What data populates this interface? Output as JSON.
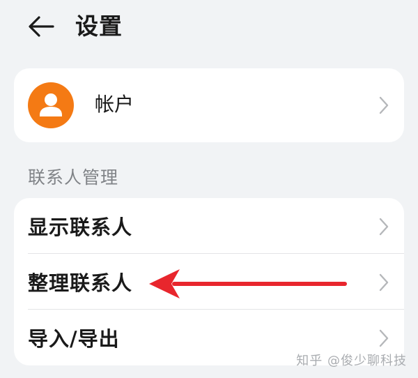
{
  "header": {
    "back_icon": "arrow-left-icon",
    "title": "设置"
  },
  "account": {
    "avatar_icon": "user-icon",
    "label": "帐户",
    "chevron_icon": "chevron-right-icon"
  },
  "contacts_section": {
    "title": "联系人管理",
    "items": [
      {
        "label": "显示联系人",
        "chevron_icon": "chevron-right-icon"
      },
      {
        "label": "整理联系人",
        "chevron_icon": "chevron-right-icon"
      },
      {
        "label": "导入/导出",
        "chevron_icon": "chevron-right-icon"
      }
    ]
  },
  "annotation": {
    "arrow_color": "#e8262d",
    "points_to": "整理联系人"
  },
  "watermark": "知乎 @俊少聊科技",
  "colors": {
    "background": "#f1f3f5",
    "card": "#ffffff",
    "avatar": "#f47a14",
    "secondary_text": "#808387",
    "chevron": "#b5b7ba"
  }
}
